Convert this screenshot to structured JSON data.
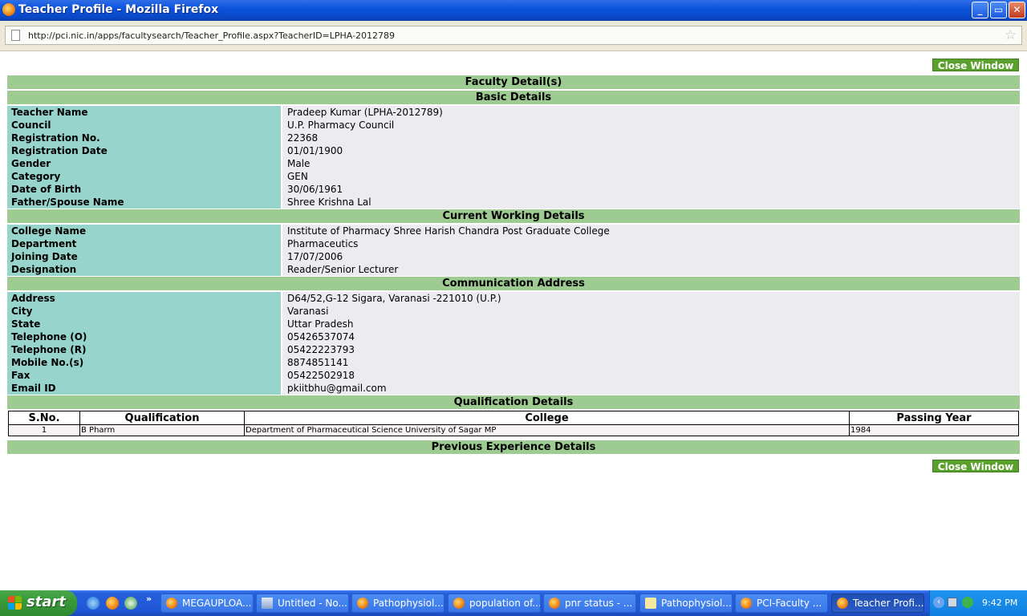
{
  "window": {
    "title": "Teacher Profile - Mozilla Firefox"
  },
  "browser": {
    "url": "http://pci.nic.in/apps/facultysearch/Teacher_Profile.aspx?TeacherID=LPHA-2012789"
  },
  "page": {
    "close_label": "Close Window",
    "main_title": "Faculty Detail(s)",
    "basic": {
      "heading": "Basic Details",
      "rows": [
        {
          "label": "Teacher Name",
          "value": "Pradeep Kumar (LPHA-2012789)"
        },
        {
          "label": "Council",
          "value": "U.P. Pharmacy Council"
        },
        {
          "label": "Registration No.",
          "value": "22368"
        },
        {
          "label": "Registration Date",
          "value": "01/01/1900"
        },
        {
          "label": "Gender",
          "value": "Male"
        },
        {
          "label": "Category",
          "value": "GEN"
        },
        {
          "label": "Date of Birth",
          "value": "30/06/1961"
        },
        {
          "label": "Father/Spouse Name",
          "value": "Shree Krishna Lal"
        }
      ]
    },
    "working": {
      "heading": "Current Working Details",
      "rows": [
        {
          "label": "College Name",
          "value": "Institute of Pharmacy Shree Harish Chandra Post Graduate College"
        },
        {
          "label": "Department",
          "value": "Pharmaceutics"
        },
        {
          "label": "Joining Date",
          "value": "17/07/2006"
        },
        {
          "label": "Designation",
          "value": "Reader/Senior Lecturer"
        }
      ]
    },
    "address": {
      "heading": "Communication Address",
      "rows": [
        {
          "label": "Address",
          "value": "D64/52,G-12 Sigara, Varanasi -221010 (U.P.)"
        },
        {
          "label": "City",
          "value": "Varanasi"
        },
        {
          "label": "State",
          "value": "Uttar Pradesh"
        },
        {
          "label": "Telephone (O)",
          "value": "05426537074"
        },
        {
          "label": "Telephone (R)",
          "value": "05422223793"
        },
        {
          "label": "Mobile No.(s)",
          "value": "8874851141"
        },
        {
          "label": "Fax",
          "value": "05422502918"
        },
        {
          "label": "Email ID",
          "value": "pkiitbhu@gmail.com"
        }
      ]
    },
    "qualification": {
      "heading": "Qualification Details",
      "columns": [
        "S.No.",
        "Qualification",
        "College",
        "Passing Year"
      ],
      "rows": [
        {
          "sno": "1",
          "qualification": "B Pharm",
          "college": "Department of Pharmaceutical Science University of Sagar MP",
          "year": "1984"
        }
      ]
    },
    "experience": {
      "heading": "Previous Experience Details"
    }
  },
  "taskbar": {
    "start_label": "start",
    "chevron": "»",
    "tasks": [
      {
        "label": "MEGAUPLOA...",
        "icon": "firefox-icon"
      },
      {
        "label": "Untitled - No...",
        "icon": "notepad-icon"
      },
      {
        "label": "Pathophysiol...",
        "icon": "firefox-icon"
      },
      {
        "label": "population of...",
        "icon": "firefox-icon"
      },
      {
        "label": "pnr status - ...",
        "icon": "firefox-icon"
      },
      {
        "label": "Pathophysiol...",
        "icon": "help-icon"
      },
      {
        "label": "PCI-Faculty ...",
        "icon": "firefox-icon"
      },
      {
        "label": "Teacher Profi...",
        "icon": "firefox-icon"
      }
    ],
    "clock": "9:42 PM"
  }
}
